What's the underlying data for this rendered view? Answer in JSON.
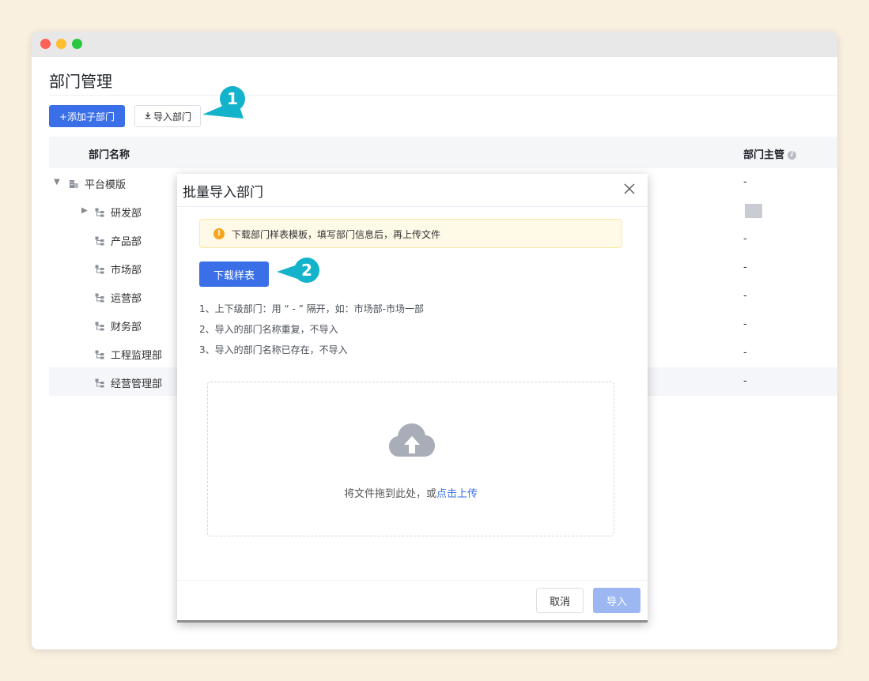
{
  "page": {
    "title": "部门管理"
  },
  "toolbar": {
    "add_label": "+添加子部门",
    "import_label": "导入部门",
    "import_icon": "download-icon"
  },
  "callouts": {
    "one": "1",
    "two": "2",
    "color": "#14b3cc"
  },
  "table": {
    "col_name": "部门名称",
    "col_manager": "部门主管",
    "rows": [
      {
        "label": "平台模版",
        "manager": "-"
      },
      {
        "label": "研发部",
        "manager": ""
      },
      {
        "label": "产品部",
        "manager": "-"
      },
      {
        "label": "市场部",
        "manager": "-"
      },
      {
        "label": "运营部",
        "manager": "-"
      },
      {
        "label": "财务部",
        "manager": "-"
      },
      {
        "label": "工程监理部",
        "manager": "-"
      },
      {
        "label": "经营管理部",
        "manager": "-"
      }
    ]
  },
  "modal": {
    "title": "批量导入部门",
    "alert": "下载部门样表模板，填写部门信息后，再上传文件",
    "download_label": "下载样表",
    "rules": [
      "1、上下级部门：用 “ - ” 隔开，如：市场部-市场一部",
      "2、导入的部门名称重复，不导入",
      "3、导入的部门名称已存在，不导入"
    ],
    "drop_text": "将文件拖到此处，或",
    "drop_link": "点击上传",
    "cancel_label": "取消",
    "submit_label": "导入"
  },
  "colors": {
    "primary": "#3a6fe8",
    "primary_disabled": "#9cb7f2",
    "warning": "#f5a623"
  }
}
